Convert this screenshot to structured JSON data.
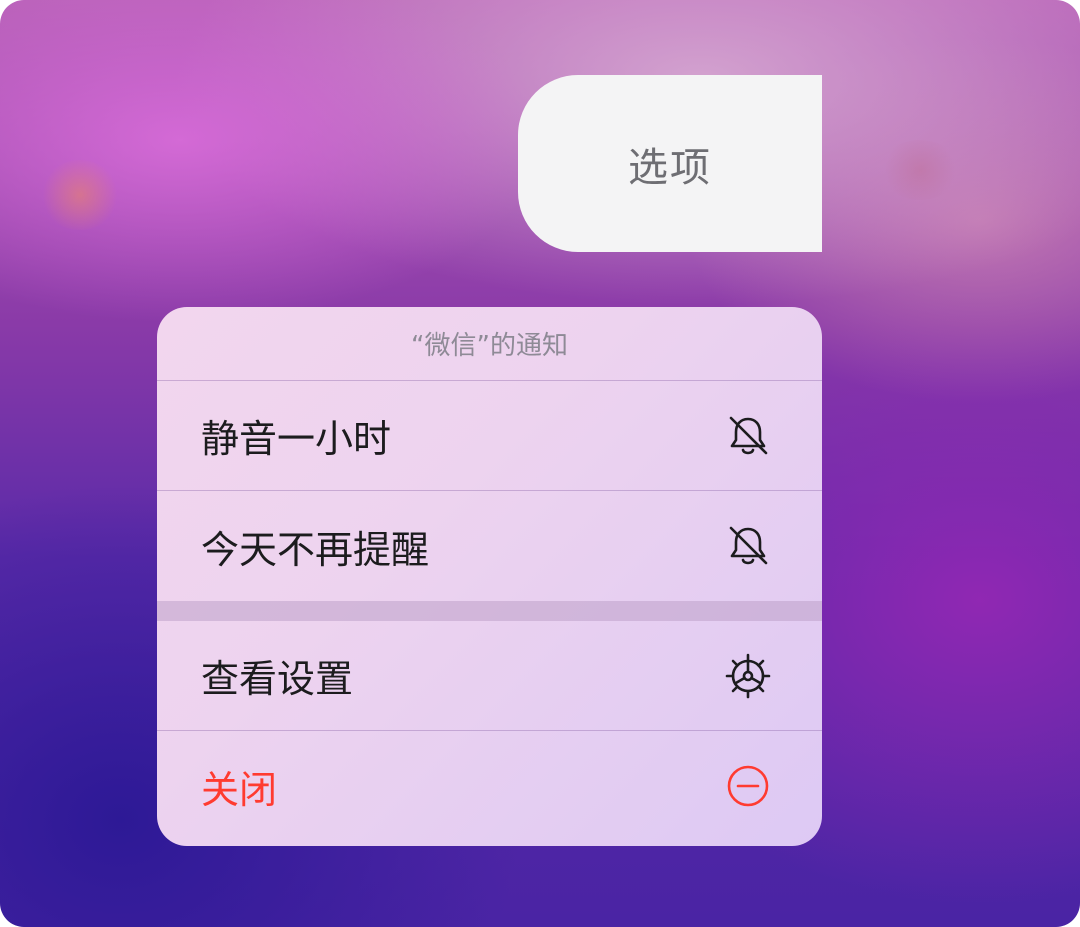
{
  "options_button": {
    "label": "选项"
  },
  "menu": {
    "header": "“微信”的通知",
    "items": [
      {
        "label": "静音一小时",
        "icon": "bell-slash-icon"
      },
      {
        "label": "今天不再提醒",
        "icon": "bell-slash-icon"
      },
      {
        "label": "查看设置",
        "icon": "gear-icon"
      },
      {
        "label": "关闭",
        "icon": "minus-circle-icon",
        "color": "#ff3b30"
      }
    ]
  },
  "colors": {
    "destructive": "#ff3b30",
    "options_bg": "#f4f4f5"
  }
}
